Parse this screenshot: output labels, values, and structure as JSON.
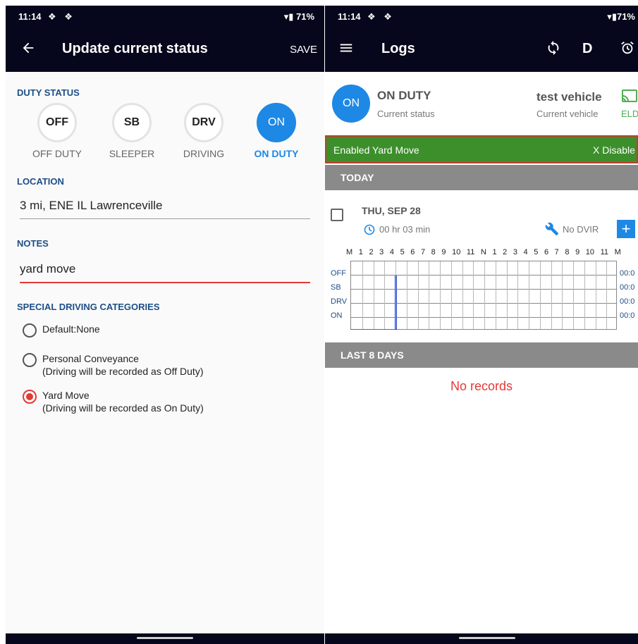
{
  "colors": {
    "appbar": "#06061c",
    "accent": "#1e88e5",
    "error_red": "#e53935",
    "banner_green": "#3d8f2b",
    "eld_green": "#4caf50"
  },
  "left": {
    "status": {
      "time": "11:14",
      "notif_icons": "❖ ❖",
      "battery": "▾▮ 71%"
    },
    "title": "Update current status",
    "save_label": "SAVE",
    "duty_status_label": "DUTY STATUS",
    "duty_buttons": [
      {
        "code": "OFF",
        "label": "OFF DUTY"
      },
      {
        "code": "SB",
        "label": "SLEEPER"
      },
      {
        "code": "DRV",
        "label": "DRIVING"
      },
      {
        "code": "ON",
        "label": "ON DUTY"
      }
    ],
    "location_label": "LOCATION",
    "location_value": "3 mi, ENE IL Lawrenceville",
    "notes_label": "NOTES",
    "notes_value": "yard move",
    "special_label": "SPECIAL DRIVING CATEGORIES",
    "options": [
      {
        "line1": "Default:None",
        "line2": ""
      },
      {
        "line1": "Personal Conveyance",
        "line2": "(Driving will be recorded as Off Duty)"
      },
      {
        "line1": "Yard Move",
        "line2": "(Driving will be recorded as On Duty)"
      }
    ]
  },
  "right": {
    "status": {
      "time": "11:14",
      "notif_icons": "❖ ❖",
      "battery": "▾▮71%"
    },
    "title": "Logs",
    "d_label": "D",
    "current_status_code": "ON",
    "current_status_title": "ON DUTY",
    "current_status_sub": "Current status",
    "vehicle_name": "test vehicle",
    "vehicle_sub": "Current vehicle",
    "eld_label": "ELD",
    "banner_text": "Enabled Yard Move",
    "banner_action": "X Disable",
    "today_label": "TODAY",
    "day_label": "THU, SEP 28",
    "duration": "00 hr  03 min",
    "dvir_label": "No DVIR",
    "plus_label": "+",
    "hour_labels": [
      "M",
      "1",
      "2",
      "3",
      "4",
      "5",
      "6",
      "7",
      "8",
      "9",
      "10",
      "11",
      "N",
      "1",
      "2",
      "3",
      "4",
      "5",
      "6",
      "7",
      "8",
      "9",
      "10",
      "11",
      "M"
    ],
    "row_labels": [
      "OFF",
      "SB",
      "DRV",
      "ON"
    ],
    "row_totals": [
      "00:0",
      "00:0",
      "00:0",
      "00:0"
    ],
    "last8_label": "LAST 8 DAYS",
    "no_records": "No records"
  }
}
